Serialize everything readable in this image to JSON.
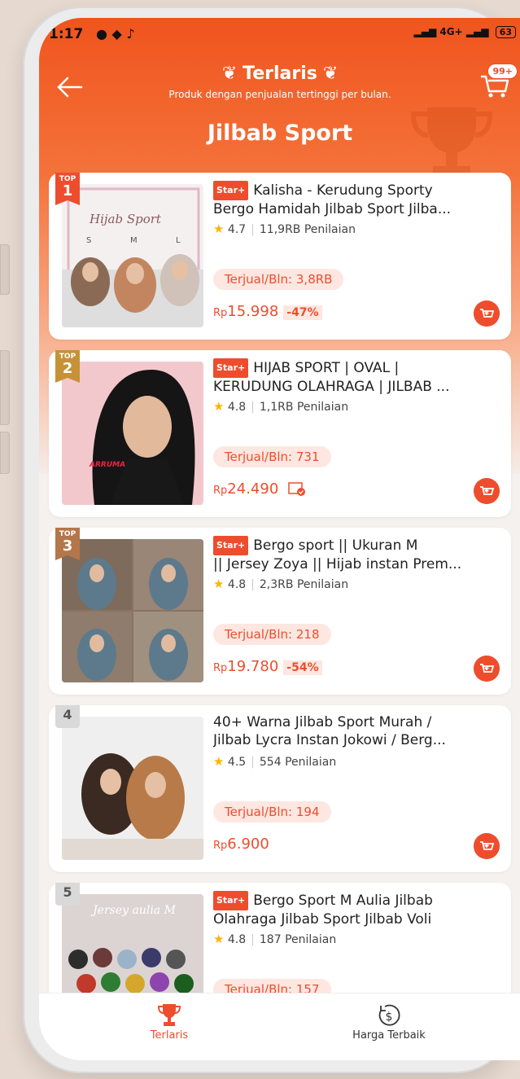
{
  "status_bar": {
    "time": "1:17",
    "network": "4G+",
    "battery": "63"
  },
  "header": {
    "title": "Terlaris",
    "subtitle": "Produk dengan penjualan tertinggi per bulan.",
    "category": "Jilbab Sport",
    "cart_badge": "99+"
  },
  "products": [
    {
      "rank_label": "TOP",
      "rank": "1",
      "star_plus": "Star+",
      "name_line1": "Kalisha - Kerudung Sporty",
      "name_line2": "Bergo Hamidah Jilbab Sport Jilba...",
      "rating": "4.7",
      "reviews": "11,9RB Penilaian",
      "sold": "Terjual/Bln: 3,8RB",
      "price_currency": "Rp",
      "price": "15.998",
      "discount": "-47%",
      "thumb_text": "Hijab Sport",
      "thumb_sizes": [
        "S",
        "M",
        "L"
      ]
    },
    {
      "rank_label": "TOP",
      "rank": "2",
      "star_plus": "Star+",
      "name_line1": "HIJAB SPORT | OVAL |",
      "name_line2": "KERUDUNG OLAHRAGA | JILBAB ...",
      "rating": "4.8",
      "reviews": "1,1RB Penilaian",
      "sold": "Terjual/Bln: 731",
      "price_currency": "Rp",
      "price": "24.490",
      "discount": "",
      "thumb_text": "ARRUMA"
    },
    {
      "rank_label": "TOP",
      "rank": "3",
      "star_plus": "Star+",
      "name_line1": "Bergo sport || Ukuran M",
      "name_line2": "|| Jersey Zoya || Hijab instan Prem...",
      "rating": "4.8",
      "reviews": "2,3RB Penilaian",
      "sold": "Terjual/Bln: 218",
      "price_currency": "Rp",
      "price": "19.780",
      "discount": "-54%"
    },
    {
      "rank_label": "",
      "rank": "4",
      "star_plus": "",
      "name_line1": "40+ Warna Jilbab Sport Murah /",
      "name_line2": "Jilbab Lycra Instan Jokowi / Berg...",
      "rating": "4.5",
      "reviews": "554 Penilaian",
      "sold": "Terjual/Bln: 194",
      "price_currency": "Rp",
      "price": "6.900",
      "discount": ""
    },
    {
      "rank_label": "",
      "rank": "5",
      "star_plus": "Star+",
      "name_line1": "Bergo Sport M Aulia Jilbab",
      "name_line2": "Olahraga Jilbab Sport Jilbab Voli",
      "rating": "4.8",
      "reviews": "187 Penilaian",
      "sold": "Terjual/Bln: 157",
      "price_currency": "Rp",
      "price": "",
      "discount": "",
      "thumb_text": "Jersey aulia M"
    }
  ],
  "tabs": [
    {
      "label": "Terlaris",
      "icon": "trophy-icon",
      "active": true
    },
    {
      "label": "Harga Terbaik",
      "icon": "dollar-icon",
      "active": false
    }
  ],
  "colors": {
    "accent": "#ee4d2d",
    "gold": "#e8a33b",
    "silver": "#b98f3c",
    "bronze": "#b4764a"
  }
}
